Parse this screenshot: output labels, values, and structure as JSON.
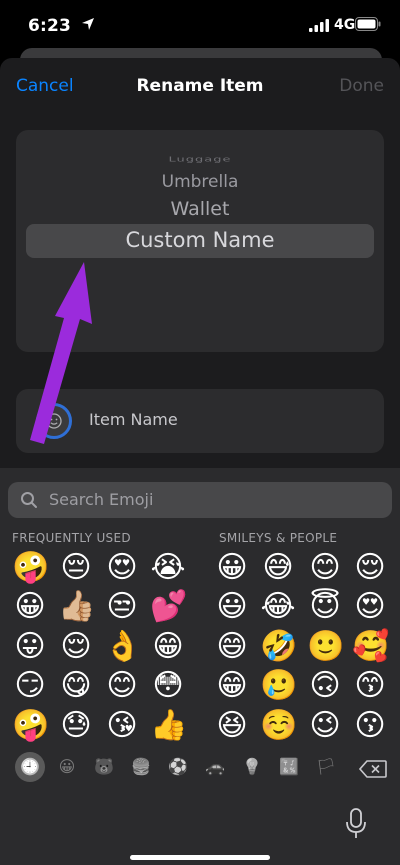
{
  "status_bar": {
    "time": "6:23",
    "network": "4G"
  },
  "nav": {
    "cancel": "Cancel",
    "title": "Rename Item",
    "done": "Done"
  },
  "picker": {
    "items": [
      "Luggage",
      "Umbrella",
      "Wallet",
      "Custom Name"
    ],
    "selected": "Custom Name"
  },
  "name_field": {
    "label": "Item Name"
  },
  "keyboard": {
    "search_placeholder": "Search Emoji",
    "sections": [
      "FREQUENTLY USED",
      "SMILEYS & PEOPLE"
    ],
    "frequently_used": [
      [
        "🤪",
        "😔",
        "😍",
        "😭"
      ],
      [
        "😀",
        "👍🏼",
        "😒",
        "💕"
      ],
      [
        "😛",
        "😌",
        "👌",
        "😁"
      ],
      [
        "😏",
        "😋",
        "😊",
        "😳"
      ],
      [
        "🤪",
        "😓",
        "😘",
        "👍"
      ]
    ],
    "smileys_people": [
      [
        "😀",
        "😅",
        "😊",
        "😌"
      ],
      [
        "😃",
        "😂",
        "😇",
        "😍"
      ],
      [
        "😄",
        "🤣",
        "🙂",
        "🥰"
      ],
      [
        "😁",
        "🥲",
        "🙃",
        "😙"
      ],
      [
        "😆",
        "☺️",
        "😉",
        "😗"
      ]
    ],
    "categories": [
      {
        "icon": "recent-clock-icon",
        "glyph": "🕘",
        "selected": true
      },
      {
        "icon": "smiley-icon",
        "glyph": "😀",
        "selected": false
      },
      {
        "icon": "animal-icon",
        "glyph": "🐻",
        "selected": false
      },
      {
        "icon": "food-icon",
        "glyph": "🍔",
        "selected": false
      },
      {
        "icon": "activity-icon",
        "glyph": "⚽",
        "selected": false
      },
      {
        "icon": "travel-icon",
        "glyph": "🚗",
        "selected": false
      },
      {
        "icon": "objects-icon",
        "glyph": "💡",
        "selected": false
      },
      {
        "icon": "symbols-icon",
        "glyph": "🔣",
        "selected": false
      },
      {
        "icon": "flag-icon",
        "glyph": "🏳",
        "selected": false
      }
    ]
  },
  "colors": {
    "accent": "#0a84ff",
    "annotation_arrow": "#9b2bdc"
  }
}
